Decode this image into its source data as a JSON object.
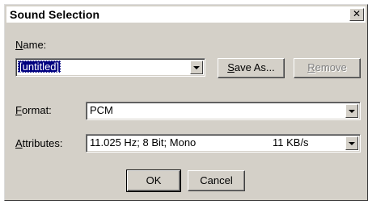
{
  "window": {
    "title": "Sound Selection",
    "close_label": "✕"
  },
  "name": {
    "label": "Name:",
    "label_mnemonic": "N",
    "label_rest": "ame:",
    "value": "[untitled]"
  },
  "buttons": {
    "save_as": {
      "mnemonic": "S",
      "rest": "ave As..."
    },
    "remove": {
      "mnemonic": "R",
      "rest": "emove"
    },
    "ok": "OK",
    "cancel": "Cancel"
  },
  "format": {
    "label_mnemonic": "F",
    "label_rest": "ormat:",
    "value": "PCM"
  },
  "attributes": {
    "label_mnemonic": "A",
    "label_rest": "ttributes:",
    "value": "11.025 Hz; 8 Bit; Mono",
    "rate": "11 KB/s"
  },
  "colors": {
    "face": "#d4d0c8",
    "selection": "#000080",
    "disabled_text": "#808080"
  }
}
